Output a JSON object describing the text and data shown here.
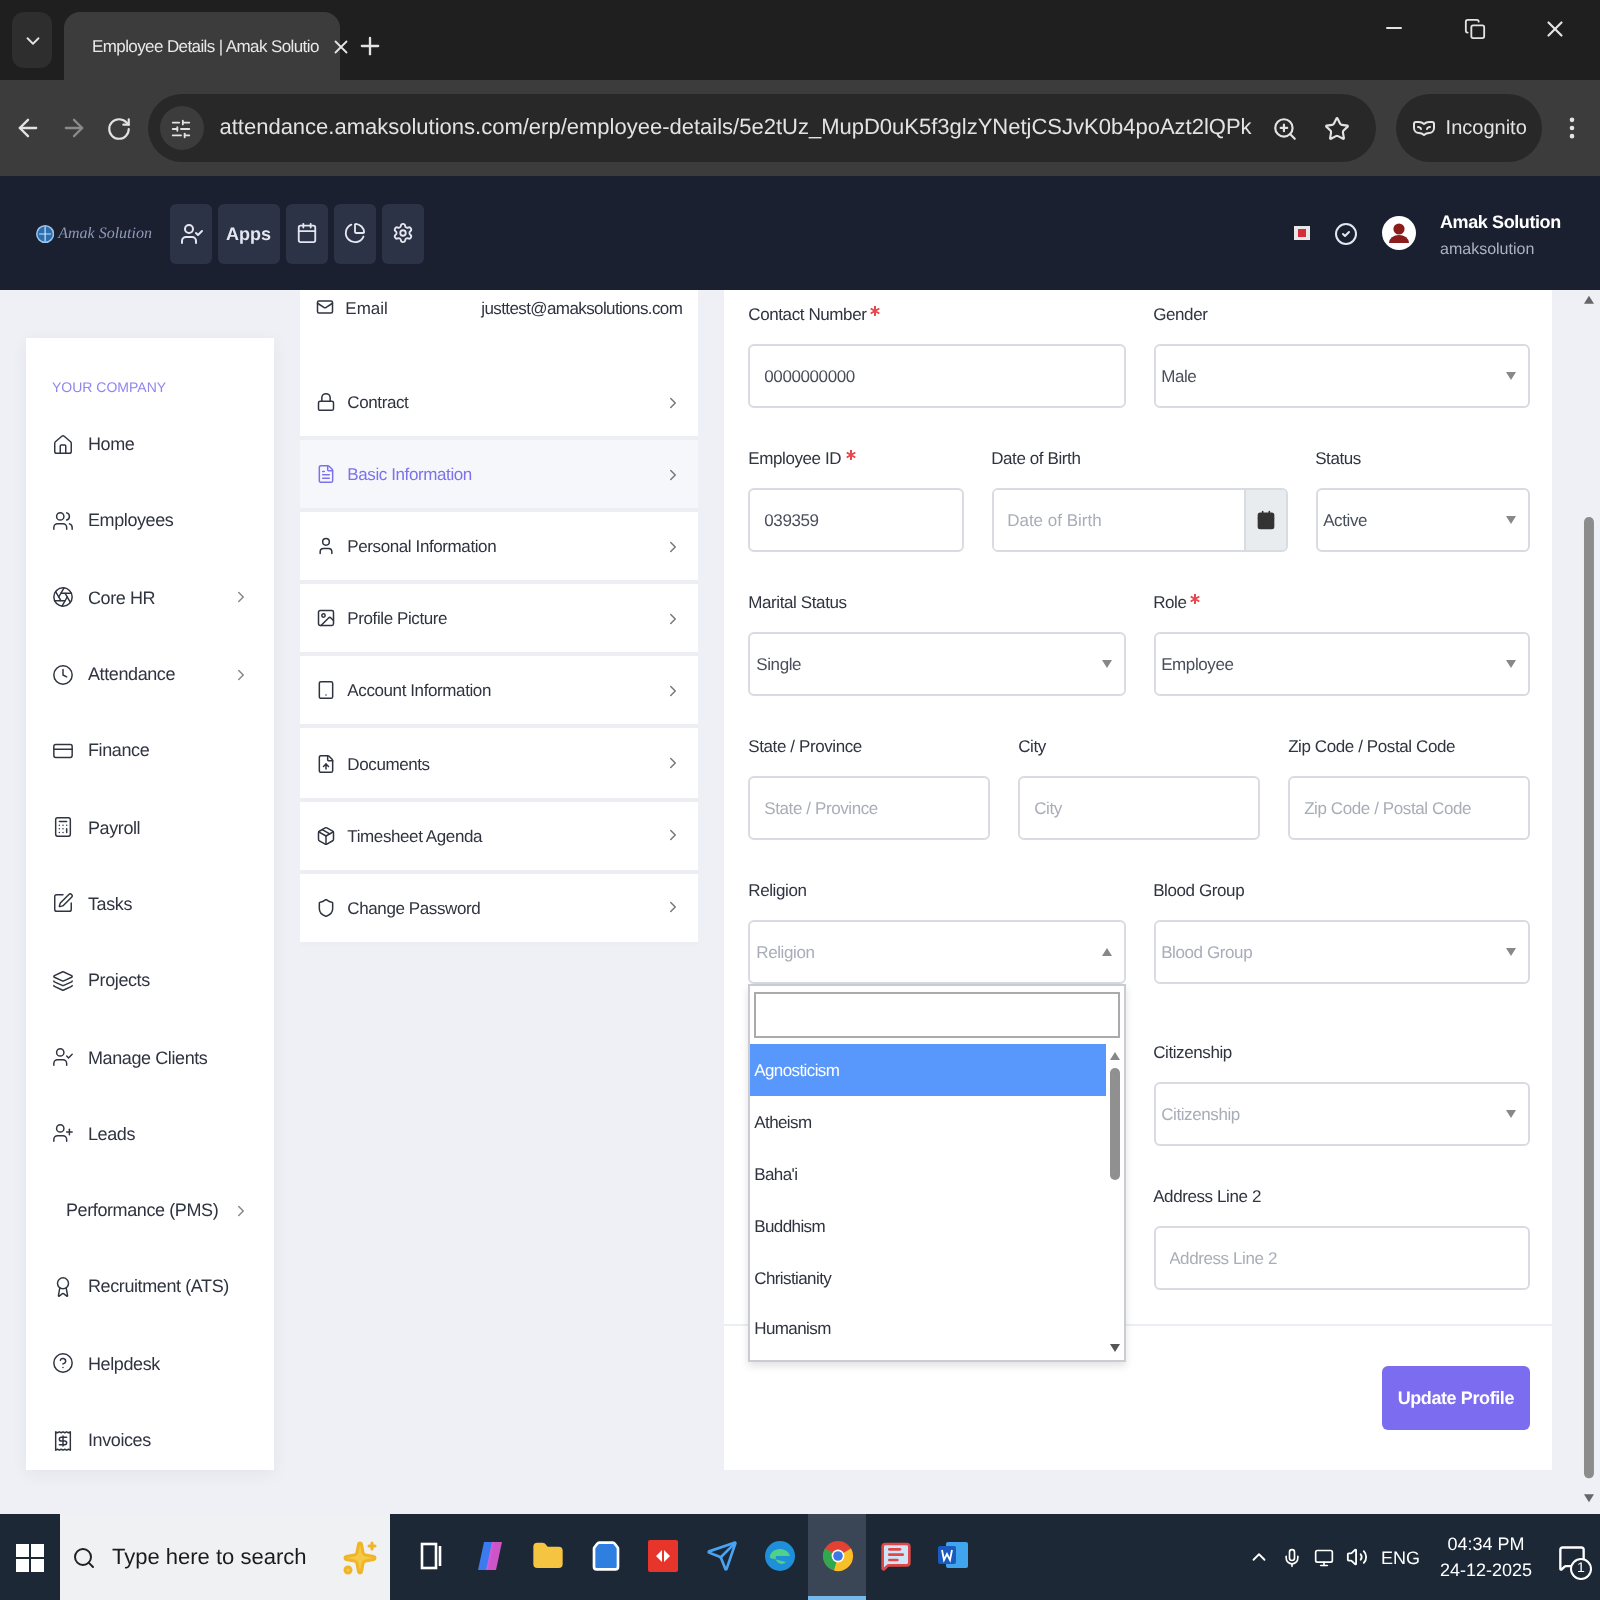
{
  "browser": {
    "tab_title": "Employee Details | Amak Solutio",
    "url": "attendance.amaksolutions.com/erp/employee-details/5e2tUz_MupD0uK5f3glzYNetjCSJvK0b4poAzt2lQPk",
    "profile": "Incognito"
  },
  "header": {
    "logo_text": "Amak Solution",
    "apps": "Apps",
    "user_name": "Amak Solution",
    "user_handle": "amaksolution"
  },
  "sidebar": {
    "section": "YOUR COMPANY",
    "items": [
      {
        "label": "Home",
        "expandable": false
      },
      {
        "label": "Employees",
        "expandable": false
      },
      {
        "label": "Core HR",
        "expandable": true
      },
      {
        "label": "Attendance",
        "expandable": true
      },
      {
        "label": "Finance",
        "expandable": false
      },
      {
        "label": "Payroll",
        "expandable": false
      },
      {
        "label": "Tasks",
        "expandable": false
      },
      {
        "label": "Projects",
        "expandable": false
      },
      {
        "label": "Manage Clients",
        "expandable": false
      },
      {
        "label": "Leads",
        "expandable": false
      },
      {
        "label": "Performance (PMS)",
        "expandable": true
      },
      {
        "label": "Recruitment (ATS)",
        "expandable": false
      },
      {
        "label": "Helpdesk",
        "expandable": false
      },
      {
        "label": "Invoices",
        "expandable": false
      }
    ]
  },
  "profile_menu": {
    "email_label": "Email",
    "email": "justtest@amaksolutions.com",
    "items": [
      {
        "label": "Contract",
        "selected": false
      },
      {
        "label": "Basic Information",
        "selected": true
      },
      {
        "label": "Personal Information",
        "selected": false
      },
      {
        "label": "Profile Picture",
        "selected": false
      },
      {
        "label": "Account Information",
        "selected": false
      },
      {
        "label": "Documents",
        "selected": false
      },
      {
        "label": "Timesheet Agenda",
        "selected": false
      },
      {
        "label": "Change Password",
        "selected": false
      }
    ]
  },
  "form": {
    "rows": [
      {
        "fields": [
          {
            "label": "Contact Number",
            "required": true,
            "kind": "text",
            "value": "0000000000"
          },
          {
            "label": "Gender",
            "required": false,
            "kind": "select",
            "value": "Male",
            "open": false
          }
        ]
      },
      {
        "fields": [
          {
            "label": "Employee ID",
            "required": true,
            "kind": "text",
            "value": "039359"
          },
          {
            "label": "Date of Birth",
            "required": false,
            "kind": "date",
            "placeholder": "Date of Birth"
          },
          {
            "label": "Status",
            "required": false,
            "kind": "select",
            "value": "Active",
            "open": false
          }
        ]
      },
      {
        "fields": [
          {
            "label": "Marital Status",
            "required": false,
            "kind": "select",
            "value": "Single",
            "open": false
          },
          {
            "label": "Role",
            "required": true,
            "kind": "select",
            "value": "Employee",
            "open": false
          }
        ]
      },
      {
        "fields": [
          {
            "label": "State / Province",
            "required": false,
            "kind": "text",
            "placeholder": "State / Province"
          },
          {
            "label": "City",
            "required": false,
            "kind": "text",
            "placeholder": "City"
          },
          {
            "label": "Zip Code / Postal Code",
            "required": false,
            "kind": "text",
            "placeholder": "Zip Code / Postal Code"
          }
        ]
      },
      {
        "fields": [
          {
            "label": "Religion",
            "required": false,
            "kind": "select",
            "placeholder": "Religion",
            "open": true
          },
          {
            "label": "Blood Group",
            "required": false,
            "kind": "select",
            "placeholder": "Blood Group",
            "open": false
          }
        ]
      },
      {
        "fields": [
          {
            "label": "Citizenship",
            "required": false,
            "kind": "select",
            "placeholder": "Citizenship",
            "open": false
          }
        ]
      },
      {
        "fields": [
          {
            "label": "Address Line 2",
            "required": false,
            "kind": "text",
            "placeholder": "Address Line 2"
          }
        ]
      }
    ],
    "dropdown": {
      "options": [
        {
          "label": "Agnosticism",
          "selected": true
        },
        {
          "label": "Atheism",
          "selected": false
        },
        {
          "label": "Baha'i",
          "selected": false
        },
        {
          "label": "Buddhism",
          "selected": false
        },
        {
          "label": "Christianity",
          "selected": false
        },
        {
          "label": "Humanism",
          "selected": false
        }
      ]
    },
    "submit": "Update Profile"
  },
  "taskbar": {
    "search_placeholder": "Type here to search",
    "apps": [
      {
        "active": false
      },
      {
        "active": false
      },
      {
        "active": false
      },
      {
        "active": false
      },
      {
        "active": false
      },
      {
        "active": false
      },
      {
        "active": false
      },
      {
        "active": true
      },
      {
        "active": false
      },
      {
        "active": false
      }
    ],
    "language": "ENG",
    "time": "04:34 PM",
    "date": "24-12-2025",
    "notifications": "1"
  }
}
